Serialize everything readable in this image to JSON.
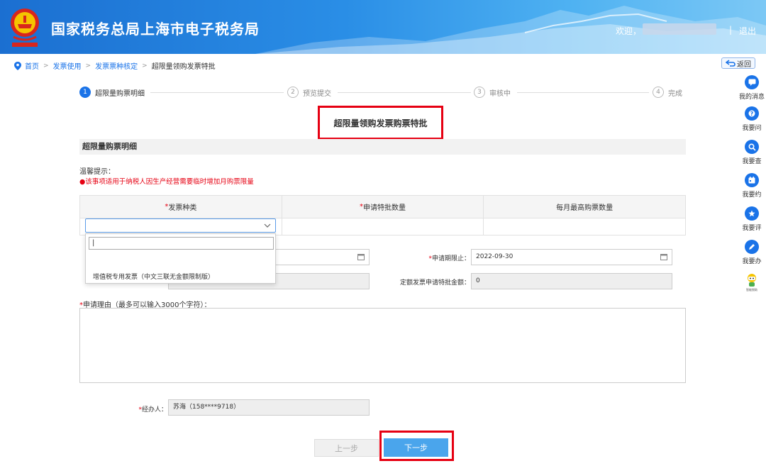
{
  "header": {
    "site_title": "国家税务总局上海市电子税务局",
    "welcome": "欢迎，",
    "separator": "|",
    "logout": "退出"
  },
  "breadcrumb": {
    "home": "首页",
    "level1": "发票使用",
    "level2": "发票票种核定",
    "current": "超限量领购发票特批",
    "arrow": ">"
  },
  "back_button": "返回",
  "sidebar": {
    "items": [
      {
        "label": "我的消息",
        "icon": "message-icon"
      },
      {
        "label": "我要问",
        "icon": "question-icon"
      },
      {
        "label": "我要查",
        "icon": "search-icon"
      },
      {
        "label": "我要约",
        "icon": "calendar-icon"
      },
      {
        "label": "我要评",
        "icon": "rate-icon"
      },
      {
        "label": "我要办",
        "icon": "pen-icon"
      }
    ],
    "assistant_icon": "robot-assistant-icon",
    "assistant_label": "智能税助"
  },
  "steps": [
    {
      "num": "1",
      "label": "超限量购票明细",
      "active": true
    },
    {
      "num": "2",
      "label": "预览提交",
      "active": false
    },
    {
      "num": "3",
      "label": "审核中",
      "active": false
    },
    {
      "num": "4",
      "label": "完成",
      "active": false
    }
  ],
  "form_title": "超限量领购发票购票特批",
  "section_title": "超限量购票明细",
  "tip": {
    "title": "温馨提示：",
    "text": "●该事项适用于纳税人因生产经营需要临时增加月购票限量"
  },
  "grid": {
    "headers": [
      {
        "required": "*",
        "label": "发票种类"
      },
      {
        "required": "*",
        "label": "申请特批数量"
      },
      {
        "required": "",
        "label": "每月最高购票数量"
      }
    ]
  },
  "dropdown": {
    "search_value": "|",
    "option": "增值税专用发票（中文三联无金额限制版）"
  },
  "fields": {
    "end_date_label_req": "*",
    "end_date_label": "申请期限止：",
    "end_date_value": "2022-09-30",
    "fixed_amount_label": "定额发票申请特批金额：",
    "fixed_amount_value": "0",
    "reason_req": "*",
    "reason_label": "申请理由（最多可以输入3000个字符）：",
    "handler_req": "*",
    "handler_label": "经办人：",
    "handler_value": "苏海（158****9718）"
  },
  "buttons": {
    "prev": "上一步",
    "next": "下一步"
  },
  "colors": {
    "primary": "#1a73e8",
    "highlight_red": "#e60012",
    "next_button": "#4aa5ec"
  }
}
